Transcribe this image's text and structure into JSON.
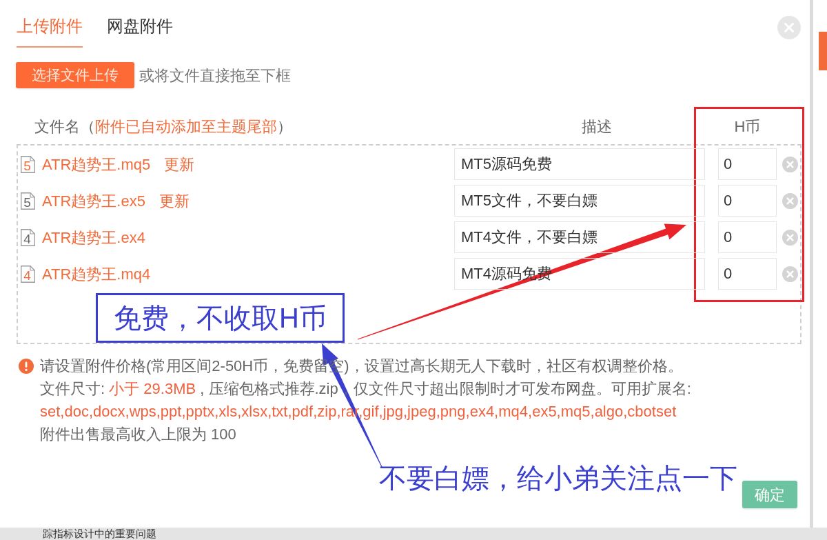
{
  "dialog": {
    "tabs": [
      {
        "label": "上传附件",
        "selected": true
      },
      {
        "label": "网盘附件",
        "selected": false
      }
    ],
    "upload_button": "选择文件上传",
    "drop_hint": "或将文件直接拖至下框",
    "columns": {
      "file": {
        "label": "文件名（",
        "note": "附件已自动添加至主题尾部",
        "tail": "）"
      },
      "description": "描述",
      "price": "H币"
    },
    "files": [
      {
        "name": "ATR趋势王.mq5",
        "kind": "source",
        "type_digit": "5",
        "update_link": "更新",
        "description": "MT5源码免费",
        "price": "0"
      },
      {
        "name": "ATR趋势王.ex5",
        "kind": "compiled",
        "type_digit": "5",
        "update_link": "更新",
        "description": "MT5文件，不要白嫖",
        "price": "0"
      },
      {
        "name": "ATR趋势王.ex4",
        "kind": "compiled",
        "type_digit": "4",
        "description": "MT4文件，不要白嫖",
        "price": "0"
      },
      {
        "name": "ATR趋势王.mq4",
        "kind": "source",
        "type_digit": "4",
        "description": "MT4源码免费",
        "price": "0"
      }
    ],
    "notes": {
      "pricing": "请设置附件价格(常用区间2-50H币，免费留空)，设置过高长期无人下载时，社区有权调整价格。",
      "size": {
        "label": "文件尺寸: ",
        "limit": "小于 29.3MB",
        "rest": " , 压缩包格式推荐.zip，仅文件尺寸超出限制时才可发布网盘。可用扩展名:"
      },
      "extensions": "set,doc,docx,wps,ppt,pptx,xls,xlsx,txt,pdf,zip,rar,gif,jpg,jpeg,png,ex4,mq4,ex5,mq5,algo,cbotset",
      "income_cap": "附件出售最高收入上限为 100"
    },
    "confirm_button": "确定"
  },
  "annotations": [
    {
      "kind": "boxed",
      "text": "免费，不收取H币"
    },
    {
      "kind": "caption",
      "text": "不要白嫖，给小弟关注点一下"
    }
  ],
  "background": {
    "heading": "踪指标设计中的重要问题"
  }
}
